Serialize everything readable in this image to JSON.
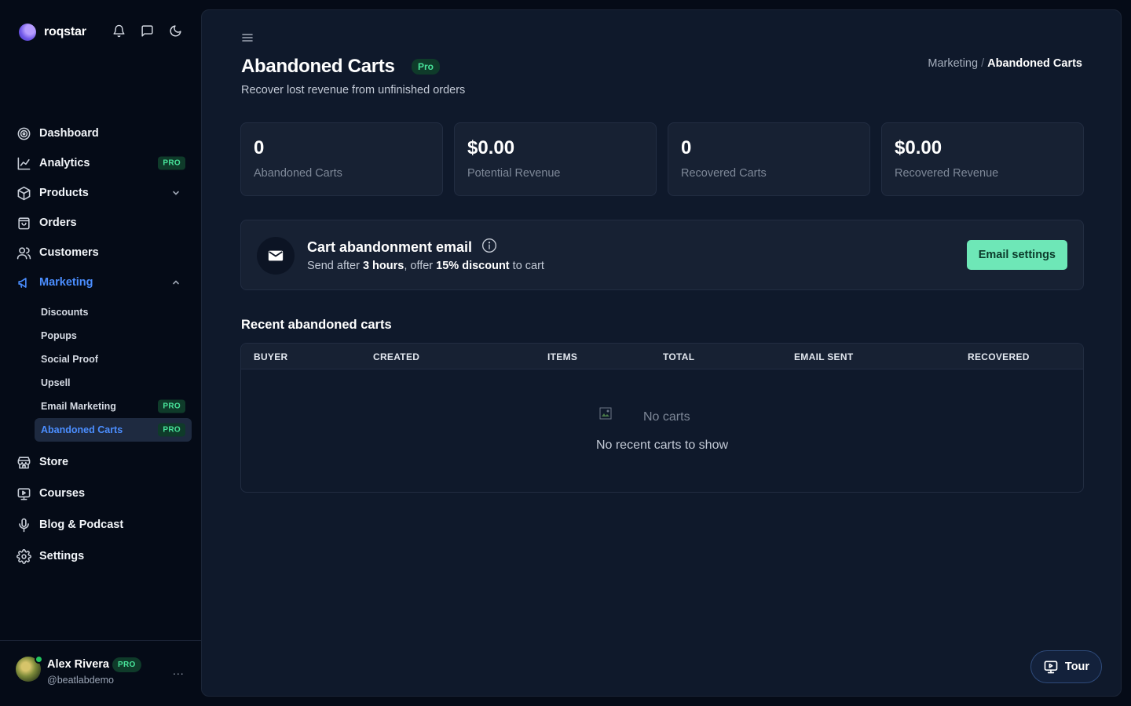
{
  "brand": {
    "name": "roqstar"
  },
  "sidebar": {
    "items": [
      {
        "label": "Dashboard",
        "icon": "dashboard-icon"
      },
      {
        "label": "Analytics",
        "icon": "analytics-icon",
        "badge": "PRO"
      },
      {
        "label": "Products",
        "icon": "products-icon"
      },
      {
        "label": "Orders",
        "icon": "orders-icon"
      },
      {
        "label": "Customers",
        "icon": "customers-icon"
      },
      {
        "label": "Marketing",
        "icon": "marketing-icon"
      },
      {
        "label": "Store",
        "icon": "store-icon"
      },
      {
        "label": "Courses",
        "icon": "courses-icon"
      },
      {
        "label": "Blog & Podcast",
        "icon": "microphone-icon"
      },
      {
        "label": "Settings",
        "icon": "gear-icon"
      }
    ],
    "marketing_sub": [
      {
        "label": "Discounts"
      },
      {
        "label": "Popups"
      },
      {
        "label": "Social Proof"
      },
      {
        "label": "Upsell"
      },
      {
        "label": "Email Marketing",
        "badge": "PRO"
      },
      {
        "label": "Abandoned Carts",
        "badge": "PRO"
      }
    ]
  },
  "user": {
    "name": "Alex Rivera",
    "badge": "PRO",
    "handle": "@beatlabdemo",
    "more": "..."
  },
  "page": {
    "title": "Abandoned Carts",
    "title_badge": "Pro",
    "subtitle": "Recover lost revenue from unfinished orders",
    "breadcrumb": {
      "parent": "Marketing",
      "separator": "/",
      "current": "Abandoned Carts"
    }
  },
  "stats": [
    {
      "value": "0",
      "label": "Abandoned Carts"
    },
    {
      "value": "$0.00",
      "label": "Potential Revenue"
    },
    {
      "value": "0",
      "label": "Recovered Carts"
    },
    {
      "value": "$0.00",
      "label": "Recovered Revenue"
    }
  ],
  "email_card": {
    "title": "Cart abandonment email",
    "desc_prefix": "Send after",
    "hours": "3 hours",
    "desc_mid": ", offer",
    "discount": "15% discount",
    "desc_suffix": "to cart",
    "button": "Email settings"
  },
  "recent": {
    "title": "Recent abandoned carts",
    "columns": [
      "BUYER",
      "CREATED",
      "ITEMS",
      "TOTAL",
      "EMAIL SENT",
      "RECOVERED"
    ],
    "empty_image_alt": "No carts",
    "empty_text": "No recent carts to show"
  },
  "tour": {
    "label": "Tour"
  },
  "colors": {
    "accent": "#4b8eff",
    "pro_bg": "#0f3b2a",
    "pro_fg": "#48e39a",
    "button_bg": "#6ee7b7"
  }
}
